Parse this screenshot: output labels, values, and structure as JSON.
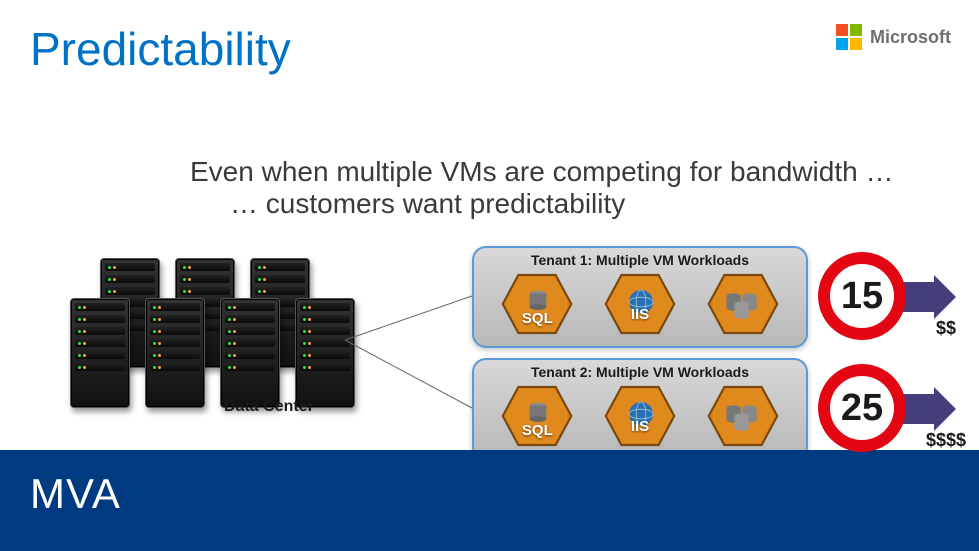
{
  "title": "Predictability",
  "brand": "Microsoft",
  "subtitle": {
    "line1": "Even when multiple VMs are competing for bandwidth …",
    "line2": "… customers want predictability"
  },
  "datacenter_label": "Data Center",
  "tenants": [
    {
      "title": "Tenant 1: Multiple VM Workloads",
      "vms": [
        "SQL",
        "IIS",
        ""
      ],
      "sla_value": "15",
      "cost": "$$"
    },
    {
      "title": "Tenant 2: Multiple VM Workloads",
      "vms": [
        "SQL",
        "IIS",
        ""
      ],
      "sla_value": "25",
      "cost": "$$$$"
    }
  ],
  "footer": "MVA"
}
